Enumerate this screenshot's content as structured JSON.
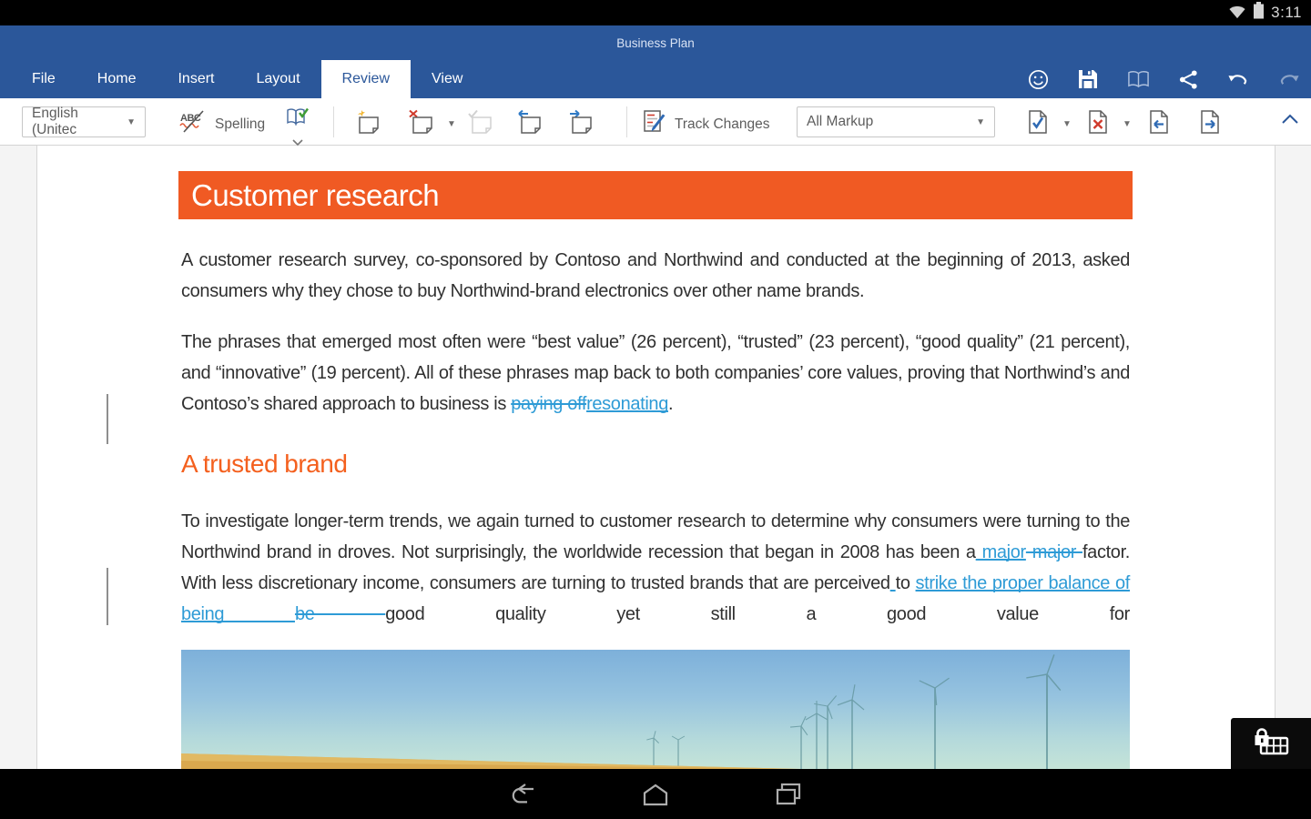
{
  "status": {
    "time": "3:11"
  },
  "titlebar": {
    "title": "Business Plan"
  },
  "tabs": [
    {
      "label": "File"
    },
    {
      "label": "Home"
    },
    {
      "label": "Insert"
    },
    {
      "label": "Layout"
    },
    {
      "label": "Review"
    },
    {
      "label": "View"
    }
  ],
  "toolbar": {
    "language": "English (Unitec",
    "spelling_label": "Spelling",
    "track_changes_label": "Track Changes",
    "markup_value": "All Markup"
  },
  "doc": {
    "h1": "Customer research",
    "p1": "A customer research survey, co-sponsored by Contoso and Northwind and conducted at the beginning of 2013, asked consumers why they chose to buy Northwind-brand electronics over other name brands.",
    "p2": {
      "s0": "The phrases that emerged most often were “best value” (26 percent), “trusted” (23 percent), “good quality” (21 percent), and “innovative” (19 percent). All of these phrases map back to both companies’ core values, proving that Northwind’s and Contoso’s shared approach to business is ",
      "del1": "paying off",
      "ins1": "resonating",
      "s1": "."
    },
    "h2": "A trusted brand",
    "p3": {
      "s0": "To investigate longer-term trends, we again turned to customer research to determine why consumers were turning to the Northwind brand in droves. Not surprisingly, the worldwide recession that began in 2008 has been a",
      "ins1": " major",
      "del1": " major ",
      "s1": "factor. With less discretionary income, consumers are turning to trusted brands that are perceived",
      "ins2": " ",
      "s2": "to ",
      "ins3": "strike the proper balance of being ",
      "del2": "be ",
      "s3": "good quality yet still a good value for"
    }
  },
  "colors": {
    "title_blue": "#2b579a",
    "accent_orange": "#f05a23",
    "heading_orange": "#f4601e",
    "tracked_change_blue": "#2e9bd6"
  }
}
